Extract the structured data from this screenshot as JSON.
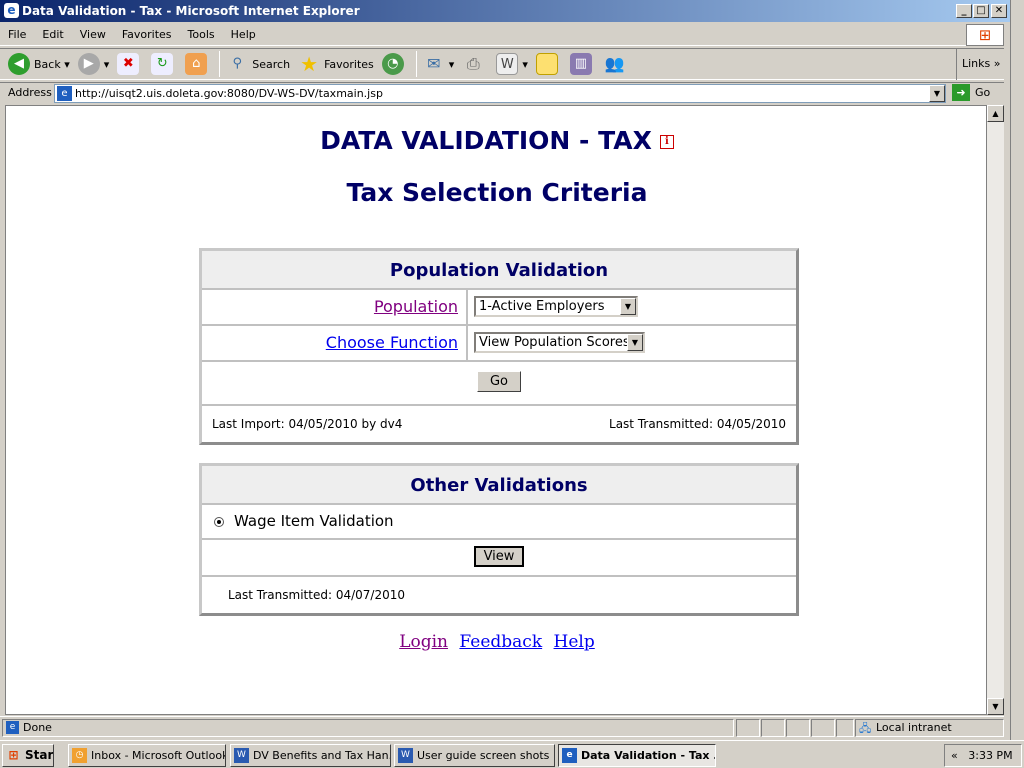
{
  "window": {
    "title": "Data Validation - Tax - Microsoft Internet Explorer"
  },
  "menu": [
    "File",
    "Edit",
    "View",
    "Favorites",
    "Tools",
    "Help"
  ],
  "toolbar": {
    "back": "Back",
    "search": "Search",
    "favorites": "Favorites",
    "links": "Links"
  },
  "address": {
    "label": "Address",
    "url": "http://uisqt2.uis.doleta.gov:8080/DV-WS-DV/taxmain.jsp",
    "go": "Go"
  },
  "page": {
    "title": "DATA VALIDATION - TAX",
    "info_icon": "i",
    "subtitle": "Tax Selection Criteria",
    "population_validation": {
      "header": "Population Validation",
      "population_label": "Population",
      "population_value": "1-Active Employers",
      "function_label": "Choose Function",
      "function_value": "View Population Scores",
      "go_button": "Go",
      "last_import": "Last Import: 04/05/2010 by dv4",
      "last_transmitted": "Last Transmitted: 04/05/2010"
    },
    "other_validations": {
      "header": "Other Validations",
      "radio_label": "Wage Item Validation",
      "radio_selected": true,
      "view_button": "View",
      "last_transmitted": "Last Transmitted: 04/07/2010"
    },
    "links": [
      "Login",
      "Feedback",
      "Help"
    ]
  },
  "status": {
    "text": "Done",
    "zone": "Local intranet"
  },
  "taskbar": {
    "start": "Start",
    "items": [
      "Inbox - Microsoft Outlook",
      "DV Benefits and Tax Han...",
      "User guide screen shots ...",
      "Data Validation - Tax ..."
    ],
    "clock": "3:33 PM",
    "chevron": "«"
  }
}
